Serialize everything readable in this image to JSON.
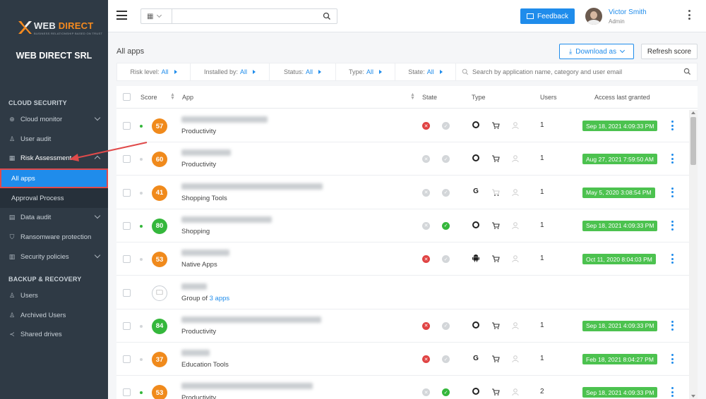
{
  "sidebar": {
    "logo_text_1": "WEB",
    "logo_text_2": "DIRECT",
    "logo_sub": "BUSINESS RELATIONSHIP BASED ON TRUST",
    "company": "WEB DIRECT SRL",
    "section_cloud": "CLOUD SECURITY",
    "section_backup": "BACKUP & RECOVERY",
    "items": {
      "cloud_monitor": "Cloud monitor",
      "user_audit": "User audit",
      "risk_assessment": "Risk Assessment",
      "all_apps": "All apps",
      "approval_process": "Approval Process",
      "data_audit": "Data audit",
      "ransomware": "Ransomware protection",
      "security_policies": "Security policies",
      "users": "Users",
      "archived_users": "Archived Users",
      "shared_drives": "Shared drives"
    }
  },
  "topbar": {
    "search_placeholder": "",
    "feedback_label": "Feedback",
    "user_name": "Victor Smith",
    "user_role": "Admin"
  },
  "content": {
    "title": "All apps",
    "download_label": "Download as",
    "refresh_label": "Refresh score",
    "filters": [
      {
        "label": "Risk level:",
        "value": "All"
      },
      {
        "label": "Installed by:",
        "value": "All"
      },
      {
        "label": "Status:",
        "value": "All"
      },
      {
        "label": "Type:",
        "value": "All"
      },
      {
        "label": "State:",
        "value": "All"
      }
    ],
    "search_placeholder": "Search by application name, category and user email"
  },
  "table": {
    "headers": {
      "score": "Score",
      "app": "App",
      "state": "State",
      "type": "Type",
      "users": "Users",
      "access": "Access last granted"
    },
    "rows": [
      {
        "score": "57",
        "score_color": "#f08a1c",
        "dot": "#35b73c",
        "category": "Productivity",
        "state1": "red",
        "state2": "grey",
        "type": "chrome",
        "users": "1",
        "access": "Sep 18, 2021 4:09:33 PM",
        "name_width": 122
      },
      {
        "score": "60",
        "score_color": "#f08a1c",
        "dot": "#d3d6d9",
        "category": "Productivity",
        "state1": "grey",
        "state2": "grey",
        "type": "chrome",
        "users": "1",
        "access": "Aug 27, 2021 7:59:50 AM",
        "name_width": 70
      },
      {
        "score": "41",
        "score_color": "#f08a1c",
        "dot": "#d3d6d9",
        "category": "Shopping Tools",
        "state1": "grey",
        "state2": "grey",
        "type": "google",
        "users": "1",
        "access": "May 5, 2020 3:08:54 PM",
        "name_width": 200
      },
      {
        "score": "80",
        "score_color": "#35b73c",
        "dot": "#35b73c",
        "category": "Shopping",
        "state1": "grey",
        "state2": "green",
        "type": "chrome",
        "users": "1",
        "access": "Sep 18, 2021 4:09:33 PM",
        "name_width": 128
      },
      {
        "score": "53",
        "score_color": "#f08a1c",
        "dot": "#d3d6d9",
        "category": "Native Apps",
        "state1": "red",
        "state2": "grey",
        "type": "android",
        "users": "1",
        "access": "Oct 11, 2020 8:04:03 PM",
        "name_width": 68
      },
      {
        "score": "",
        "score_color": "",
        "dot": "",
        "category": "Group of",
        "group_link": "3 apps",
        "state1": "",
        "state2": "",
        "type": "",
        "users": "",
        "access": "",
        "name_width": 36
      },
      {
        "score": "84",
        "score_color": "#35b73c",
        "dot": "#d3d6d9",
        "category": "Productivity",
        "state1": "red",
        "state2": "grey",
        "type": "chrome",
        "users": "1",
        "access": "Sep 18, 2021 4:09:33 PM",
        "name_width": 198
      },
      {
        "score": "37",
        "score_color": "#f08a1c",
        "dot": "#d3d6d9",
        "category": "Education Tools",
        "state1": "red",
        "state2": "grey",
        "type": "google",
        "users": "1",
        "access": "Feb 18, 2021 8:04:27 PM",
        "name_width": 40
      },
      {
        "score": "53",
        "score_color": "#f08a1c",
        "dot": "#35b73c",
        "category": "Productivity",
        "state1": "grey",
        "state2": "green",
        "type": "chrome",
        "users": "2",
        "access": "Sep 18, 2021 4:09:33 PM",
        "name_width": 186
      }
    ]
  }
}
